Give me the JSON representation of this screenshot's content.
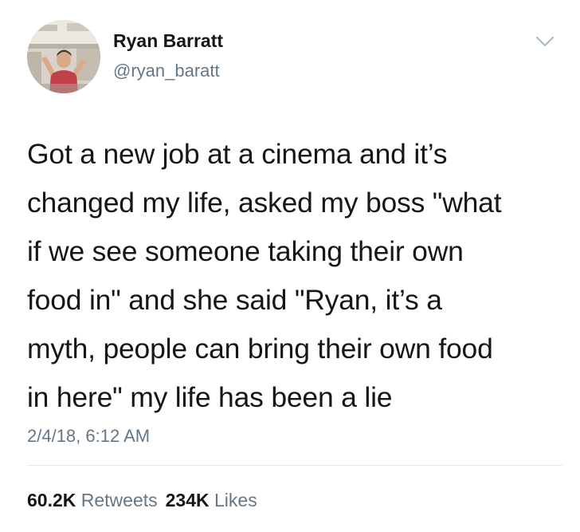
{
  "user": {
    "display_name": "Ryan Barratt",
    "handle": "@ryan_baratt"
  },
  "tweet": {
    "lines": [
      "Got a new job at a cinema and it’s",
      "changed my life, asked my boss \"what",
      "if we see someone taking their own",
      "food in\" and she said \"Ryan, it’s a",
      "myth, people can bring their own food",
      "in here\" my life has been a lie"
    ],
    "timestamp": "2/4/18, 6:12 AM"
  },
  "stats": {
    "retweets_count": "60.2K",
    "retweets_label": "Retweets",
    "likes_count": "234K",
    "likes_label": "Likes"
  },
  "icons": {
    "more": "chevron-down-icon"
  },
  "colors": {
    "text": "#14171a",
    "secondary": "#657786",
    "divider": "#e1e8ed"
  }
}
